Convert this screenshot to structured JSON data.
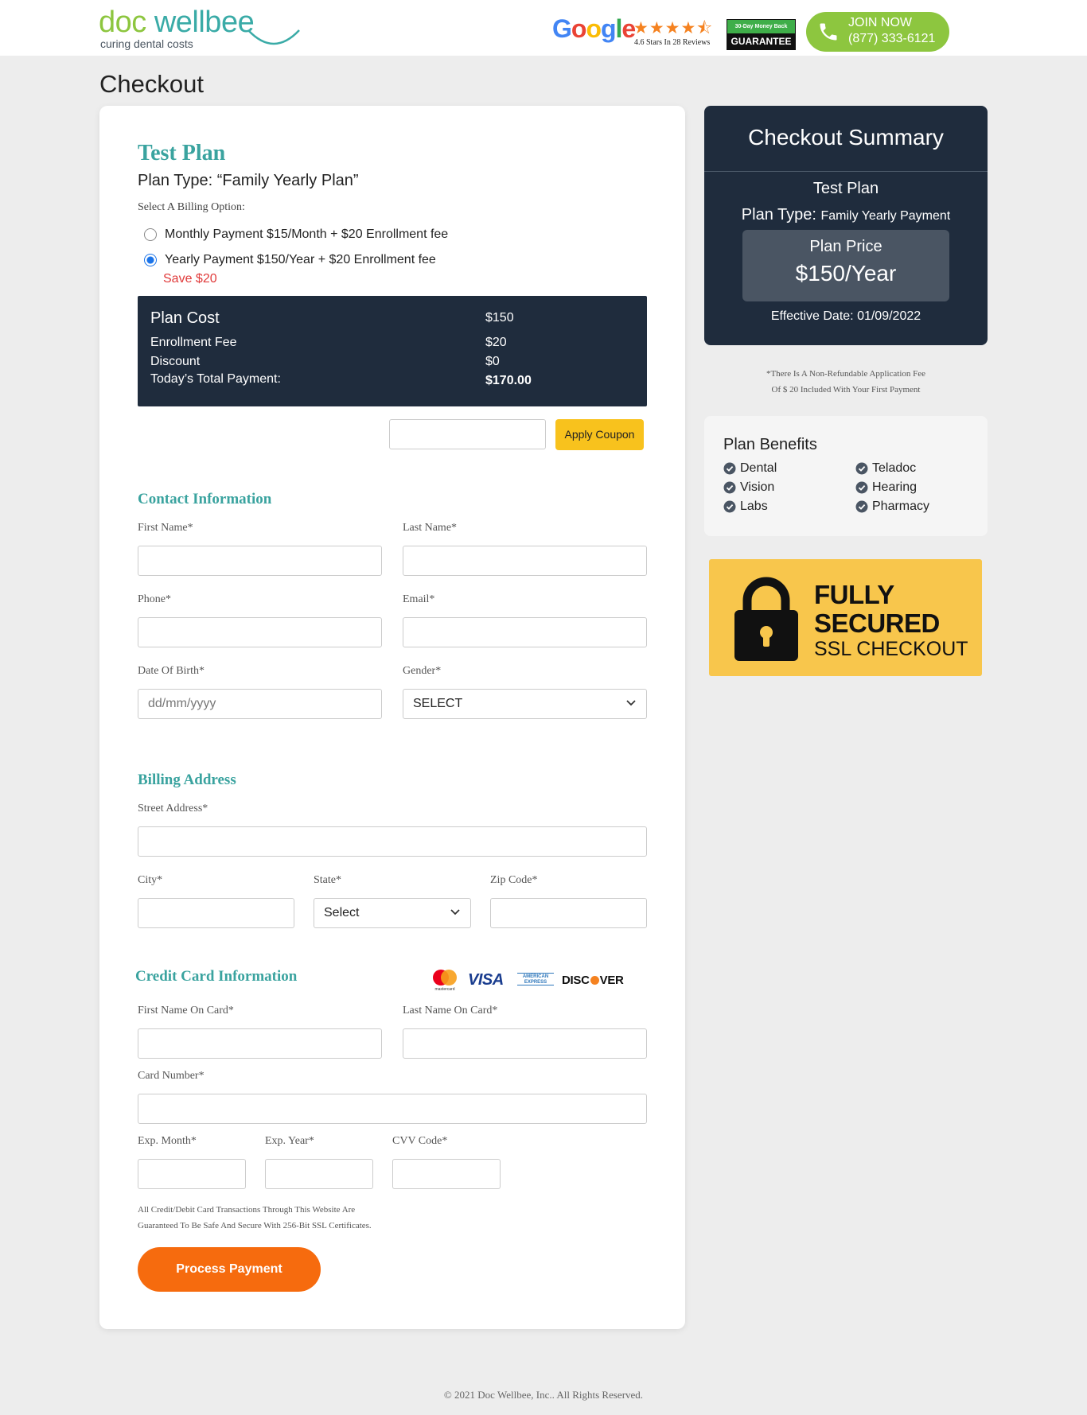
{
  "header": {
    "logo": {
      "word_doc": "doc",
      "word_wellbee": "wellbee",
      "tagline": "curing dental costs"
    },
    "google": {
      "wordmark": "Google",
      "stars": "★★★★⯪",
      "rating_text": "4.6 Stars In 28 Reviews"
    },
    "guarantee": {
      "top": "30-Day Money Back",
      "bottom": "GUARANTEE"
    },
    "join": {
      "label": "JOIN NOW",
      "phone": "(877) 333-6121"
    }
  },
  "page": {
    "title": "Checkout"
  },
  "plan": {
    "name": "Test Plan",
    "type": "Plan Type: “Family Yearly Plan”",
    "billing_label": "Select A Billing Option:",
    "options": [
      {
        "label": "Monthly Payment $15/Month + $20 Enrollment fee",
        "selected": false
      },
      {
        "label": "Yearly Payment $150/Year + $20 Enrollment fee",
        "selected": true
      }
    ],
    "save_note": "Save $20"
  },
  "costs": {
    "plan_cost_label": "Plan Cost",
    "plan_cost": "$150",
    "enrollment_label": "Enrollment Fee",
    "enrollment": "$20",
    "discount_label": "Discount",
    "discount": "$0",
    "total_label": "Today’s Total Payment:",
    "total": "$170.00"
  },
  "coupon": {
    "placeholder": "",
    "button": "Apply Coupon"
  },
  "contact": {
    "heading": "Contact Information",
    "first_name": "First Name*",
    "last_name": "Last Name*",
    "phone": "Phone*",
    "email": "Email*",
    "dob": "Date Of Birth*",
    "dob_placeholder": "dd/mm/yyyy",
    "gender": "Gender*",
    "gender_value": "SELECT"
  },
  "billing": {
    "heading": "Billing Address",
    "street": "Street Address*",
    "city": "City*",
    "state": "State*",
    "state_value": "Select",
    "zip": "Zip Code*"
  },
  "card": {
    "heading": "Credit Card Information",
    "logos": {
      "visa": "VISA",
      "amex": "AMERICAN EXPRESS",
      "discover_a": "DISC",
      "discover_b": "VER",
      "mastercard": "mastercard"
    },
    "first_name": "First Name On Card*",
    "last_name": "Last Name On Card*",
    "number": "Card Number*",
    "exp_month": "Exp. Month*",
    "exp_year": "Exp. Year*",
    "cvv": "CVV Code*",
    "ssl_note_1": "All Credit/Debit Card Transactions Through This Website Are",
    "ssl_note_2": "Guaranteed To Be Safe And Secure With 256-Bit SSL Certificates.",
    "pay_button": "Process Payment"
  },
  "summary": {
    "title": "Checkout Summary",
    "plan": "Test Plan",
    "type_label": "Plan Type:",
    "type_value": "Family Yearly Payment",
    "price_label": "Plan Price",
    "price_value": "$150/Year",
    "effective": "Effective Date: 01/09/2022"
  },
  "fee_note": {
    "line1": "*There Is A Non-Refundable Application Fee",
    "line2": "Of $ 20 Included With Your First Payment"
  },
  "benefits": {
    "title": "Plan Benefits",
    "items": [
      "Dental",
      "Teladoc",
      "Vision",
      "Hearing",
      "Labs",
      "Pharmacy"
    ]
  },
  "secured": {
    "line1": "FULLY",
    "line2": "SECURED",
    "line3": "SSL CHECKOUT"
  },
  "footer": {
    "copyright": "© 2021 Doc Wellbee, Inc.. All Rights Reserved."
  },
  "colors": {
    "accent_teal": "#3aa39f",
    "brand_green": "#8dc63f",
    "navy": "#1f2c3d",
    "orange": "#f66b0e",
    "yellow": "#f8c21d"
  }
}
